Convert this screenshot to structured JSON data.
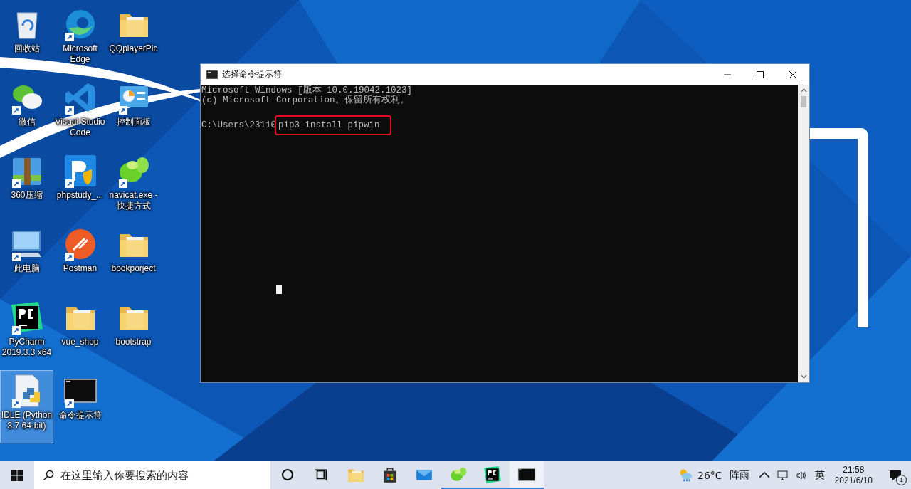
{
  "desktop": {
    "icons": [
      {
        "label": "回收站",
        "kind": "recycle-bin",
        "shortcut": false,
        "selected": false
      },
      {
        "label": "Microsoft Edge",
        "kind": "edge",
        "shortcut": true,
        "selected": false
      },
      {
        "label": "QQplayerPic",
        "kind": "folder",
        "shortcut": false,
        "selected": false
      },
      {
        "label": "微信",
        "kind": "chat",
        "shortcut": true,
        "selected": false
      },
      {
        "label": "Visual Studio Code",
        "kind": "code-editor",
        "shortcut": true,
        "selected": false
      },
      {
        "label": "控制面板",
        "kind": "control-panel",
        "shortcut": true,
        "selected": false
      },
      {
        "label": "360压缩",
        "kind": "archive",
        "shortcut": true,
        "selected": false
      },
      {
        "label": "phpstudy_...",
        "kind": "php-tool",
        "shortcut": true,
        "selected": false
      },
      {
        "label": "navicat.exe - 快捷方式",
        "kind": "navicat",
        "shortcut": true,
        "selected": false
      },
      {
        "label": "此电脑",
        "kind": "computer",
        "shortcut": true,
        "selected": false
      },
      {
        "label": "Postman",
        "kind": "postman",
        "shortcut": true,
        "selected": false
      },
      {
        "label": "bookporject",
        "kind": "folder",
        "shortcut": false,
        "selected": false
      },
      {
        "label": "PyCharm 2019.3.3 x64",
        "kind": "pycharm",
        "shortcut": true,
        "selected": false
      },
      {
        "label": "vue_shop",
        "kind": "folder",
        "shortcut": false,
        "selected": false
      },
      {
        "label": "bootstrap",
        "kind": "folder",
        "shortcut": false,
        "selected": false
      },
      {
        "label": "IDLE (Python 3.7 64-bit)",
        "kind": "python-file",
        "shortcut": true,
        "selected": true
      },
      {
        "label": "命令提示符",
        "kind": "terminal",
        "shortcut": true,
        "selected": false
      }
    ]
  },
  "window": {
    "title": "选择命令提示符",
    "lines": [
      "Microsoft Windows [版本 10.0.19042.1023]",
      "(c) Microsoft Corporation。保留所有权利。"
    ],
    "prompt": "C:\\Users\\23110",
    "command": "pip3 install pipwin"
  },
  "taskbar": {
    "search": {
      "placeholder": "在这里输入你要搜索的内容"
    },
    "apps": [
      {
        "kind": "cortana",
        "running": false,
        "selected": false
      },
      {
        "kind": "task-view",
        "running": false,
        "selected": false
      },
      {
        "kind": "file-explorer",
        "running": false,
        "selected": false
      },
      {
        "kind": "store",
        "running": false,
        "selected": false
      },
      {
        "kind": "mail",
        "running": false,
        "selected": false
      },
      {
        "kind": "navicat",
        "running": true,
        "selected": false
      },
      {
        "kind": "pycharm",
        "running": true,
        "selected": false
      },
      {
        "kind": "terminal",
        "running": true,
        "selected": true
      }
    ],
    "weather": {
      "temperature": "26°C",
      "condition": "阵雨"
    },
    "input_method": "英",
    "time": "21:58",
    "date": "2021/6/10",
    "notifications": "1"
  }
}
